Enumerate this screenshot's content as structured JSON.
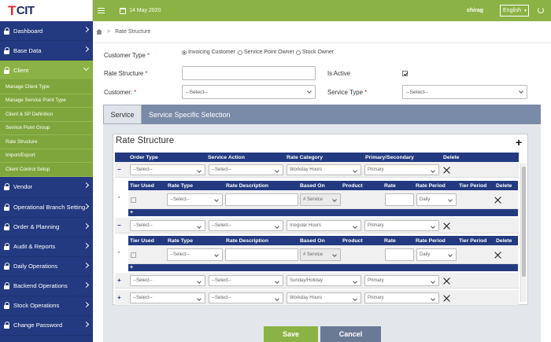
{
  "app": {
    "logo": "CIT",
    "date": "14 May 2020",
    "user": "chirag",
    "language": "English"
  },
  "sidebar": [
    {
      "label": "Dashboard"
    },
    {
      "label": "Base Data"
    },
    {
      "label": "Client",
      "active": true
    },
    {
      "label": "Vendor"
    },
    {
      "label": "Operational Branch Setting"
    },
    {
      "label": "Order & Planning"
    },
    {
      "label": "Audit & Reports"
    },
    {
      "label": "Daily Operations"
    },
    {
      "label": "Backend Operations"
    },
    {
      "label": "Stock Operations"
    },
    {
      "label": "Change Password"
    }
  ],
  "client_sub": [
    "Manage Client Type",
    "Manage Service Point Type",
    "Client & SP Definition",
    "Service Point Group",
    "Rate Structure",
    "Import/Export",
    "Client Control Setup"
  ],
  "breadcrumb": {
    "current": "Rate Structure"
  },
  "form": {
    "customer_type_label": "Customer Type",
    "customer_type_options": [
      "Invoicing Customer",
      "Service Point Owner",
      "Stock Owner"
    ],
    "rate_structure_label": "Rate Structure",
    "rate_structure_value": "",
    "is_active_label": "Is Active",
    "customer_label": "Customer:",
    "customer_value": "--Select--",
    "service_type_label": "Service Type",
    "service_type_value": "--Select--"
  },
  "tabs": [
    "Service",
    "Service Specific Selection"
  ],
  "rate_structure": {
    "title": "Rate Structure",
    "outer_headers": [
      "Order Type",
      "Service Action",
      "Rate Category",
      "Primary/Secondary",
      "Delete"
    ],
    "inner_headers": [
      "Tier Used",
      "Rate Type",
      "Rate Description",
      "Based On",
      "Product",
      "Rate",
      "Rate Period",
      "Tier Period",
      "Delete"
    ],
    "rows": [
      {
        "toggle": "−",
        "order_type": "--Select--",
        "service_action": "--Select--",
        "rate_category": "Workday Hours",
        "primary": "Primary",
        "expanded": true,
        "inner": {
          "rate_type": "--Select--",
          "based_on": "# Service",
          "rate_period": "Daily"
        }
      },
      {
        "toggle": "−",
        "order_type": "--Select--",
        "service_action": "--Select--",
        "rate_category": "Irregular Hours",
        "primary": "Primary",
        "expanded": true,
        "inner": {
          "rate_type": "--Select--",
          "based_on": "# Service",
          "rate_period": "Daily"
        }
      },
      {
        "toggle": "+",
        "order_type": "--Select--",
        "service_action": "--Select--",
        "rate_category": "Sunday/Holiday",
        "primary": "Primary"
      },
      {
        "toggle": "+",
        "order_type": "--Select--",
        "service_action": "--Select--",
        "rate_category": "Workday Hours",
        "primary": "Primary"
      }
    ]
  },
  "buttons": {
    "save": "Save",
    "cancel": "Cancel"
  }
}
